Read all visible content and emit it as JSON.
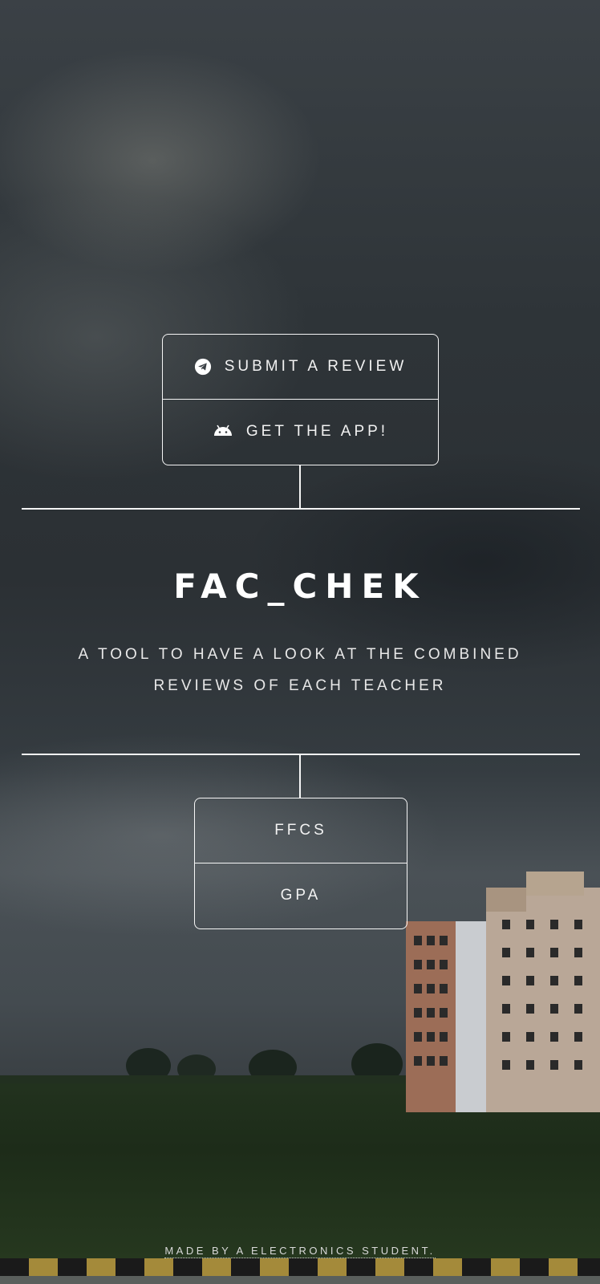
{
  "top_buttons": {
    "submit_review": {
      "label": "SUBMIT A REVIEW",
      "icon": "telegram-icon"
    },
    "get_app": {
      "label": "GET THE APP!",
      "icon": "android-icon"
    }
  },
  "hero": {
    "title": "FAC_CHEK",
    "subtitle": "A TOOL TO HAVE A LOOK AT THE COMBINED REVIEWS OF EACH TEACHER"
  },
  "bottom_buttons": {
    "ffcs": {
      "label": "FFCS"
    },
    "gpa": {
      "label": "GPA"
    }
  },
  "footer": {
    "credit": "MADE BY A ELECTRONICS STUDENT."
  },
  "colors": {
    "line": "#ffffff",
    "text": "#ffffff"
  }
}
